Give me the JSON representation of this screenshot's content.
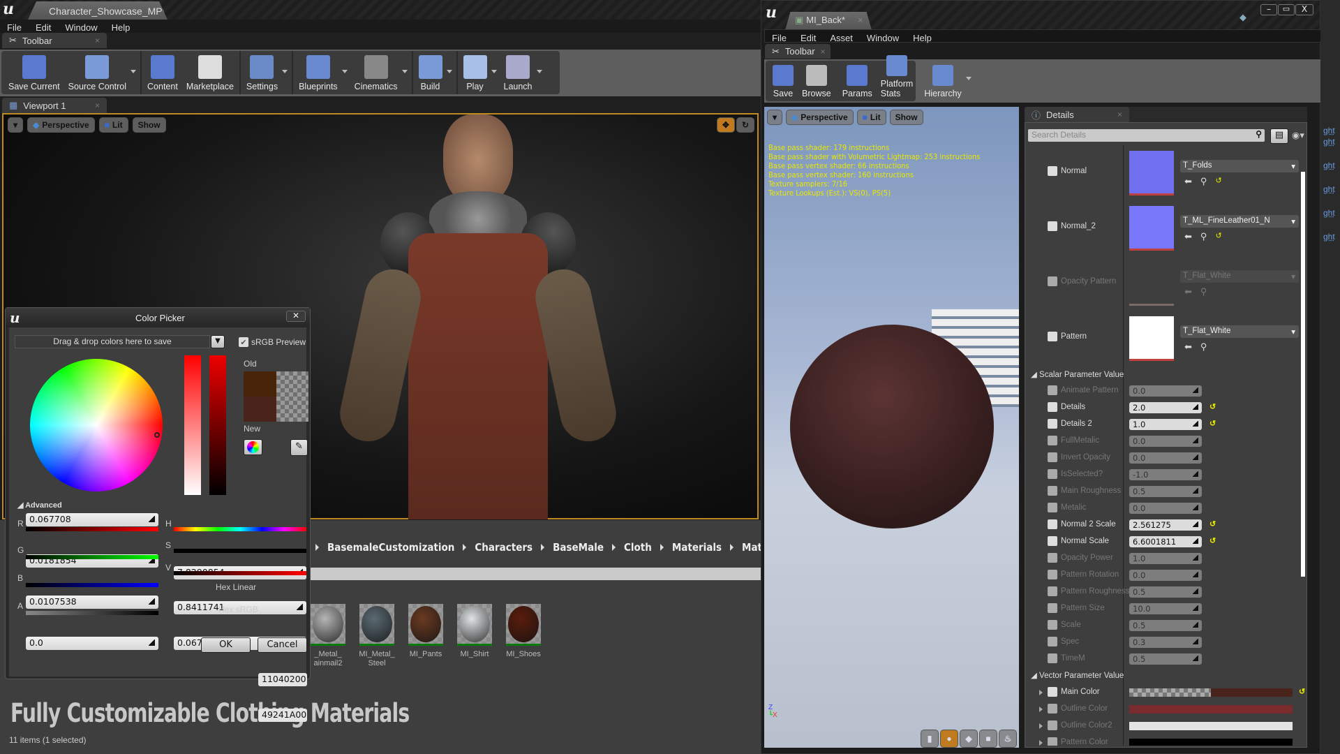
{
  "main_window": {
    "doc_tab": "Character_Showcase_MP*",
    "menu": [
      "File",
      "Edit",
      "Window",
      "Help"
    ],
    "toolbar_tab": "Toolbar",
    "toolbar": [
      {
        "label": "Save Current",
        "icon": "save-icon",
        "dropdown": false
      },
      {
        "label": "Source Control",
        "icon": "source-control-icon",
        "dropdown": true
      },
      {
        "label": "Content",
        "icon": "content-browser-icon",
        "dropdown": false
      },
      {
        "label": "Marketplace",
        "icon": "marketplace-icon",
        "dropdown": false
      },
      {
        "label": "Settings",
        "icon": "settings-icon",
        "dropdown": true
      },
      {
        "label": "Blueprints",
        "icon": "blueprints-icon",
        "dropdown": true
      },
      {
        "label": "Cinematics",
        "icon": "cinematics-icon",
        "dropdown": true
      },
      {
        "label": "Build",
        "icon": "build-icon",
        "dropdown": true
      },
      {
        "label": "Play",
        "icon": "play-icon",
        "dropdown": true
      },
      {
        "label": "Launch",
        "icon": "launch-icon",
        "dropdown": true
      }
    ],
    "viewport_tab": "Viewport 1",
    "viewport_buttons": {
      "perspective": "Perspective",
      "lit": "Lit",
      "show": "Show"
    }
  },
  "color_picker": {
    "title": "Color Picker",
    "theme_bar": "Drag & drop colors here to save",
    "srgb_preview": "sRGB Preview",
    "srgb_checked": true,
    "old_label": "Old",
    "new_label": "New",
    "old_color": "#49240a",
    "new_color": "#49241a",
    "advanced_label": "Advanced",
    "channels": {
      "R": {
        "label": "R",
        "value": "0.067708"
      },
      "G": {
        "label": "G",
        "value": "0.0181854"
      },
      "B": {
        "label": "B",
        "value": "0.0107538"
      },
      "A": {
        "label": "A",
        "value": "0.0"
      },
      "H": {
        "label": "H",
        "value": "7.8290854"
      },
      "S": {
        "label": "S",
        "value": "0.8411741"
      },
      "V": {
        "label": "V",
        "value": "0.067708"
      }
    },
    "hex_linear_label": "Hex Linear",
    "hex_linear": "11040200",
    "hex_srgb_label": "Hex sRGB",
    "hex_srgb": "49241A00",
    "ok": "OK",
    "cancel": "Cancel"
  },
  "content_browser": {
    "breadcrumb": [
      "BasemaleCustomization",
      "Characters",
      "BaseMale",
      "Cloth",
      "Materials",
      "Materia"
    ],
    "assets": [
      {
        "name": "_Metal_\nainmail2",
        "color": "#b5b5b5"
      },
      {
        "name": "MI_Metal_\nSteel",
        "color": "#5a6a72"
      },
      {
        "name": "MI_Pants",
        "color": "#6a3a22"
      },
      {
        "name": "MI_Shirt",
        "color": "#e0e4e6"
      },
      {
        "name": "MI_Shoes",
        "color": "#5a1c0c"
      }
    ],
    "overlay_title": "Fully Customizable Clothing Materials",
    "status": "11 items (1 selected)"
  },
  "material_editor": {
    "doc_tab": "MI_Back*",
    "menu": [
      "File",
      "Edit",
      "Asset",
      "Window",
      "Help"
    ],
    "toolbar_tab": "Toolbar",
    "toolbar": [
      {
        "label": "Save",
        "icon": "save-icon"
      },
      {
        "label": "Browse",
        "icon": "browse-icon"
      },
      {
        "label": "Params",
        "icon": "params-icon"
      },
      {
        "label": "Platform Stats",
        "icon": "platform-stats-icon"
      },
      {
        "label": "Hierarchy",
        "icon": "hierarchy-icon"
      }
    ],
    "viewport_buttons": {
      "perspective": "Perspective",
      "lit": "Lit",
      "show": "Show"
    },
    "stats": [
      "Base pass shader: 179 instructions",
      "Base pass shader with Volumetric Lightmap: 253 instructions",
      "Base pass vertex shader: 66 instructions",
      "Base pass vertex shader: 160 instructions",
      "Texture samplers: 7/16",
      "Texture Lookups (Est.): VS(0), PS(5)"
    ],
    "details_tab": "Details",
    "search_placeholder": "Search Details",
    "textures": [
      {
        "label": "Normal",
        "checked": true,
        "texture": "T_Folds",
        "thumb": "#7070f0",
        "bar": "#c04040",
        "reset": true
      },
      {
        "label": "Normal_2",
        "checked": true,
        "texture": "T_ML_FineLeather01_N",
        "thumb": "#7878fa",
        "bar": "#c04040",
        "reset": true
      },
      {
        "label": "Opacity Pattern",
        "checked": false,
        "texture": "T_Flat_White",
        "thumb": "#3e3e3e",
        "bar": "#7a6a6a",
        "reset": false
      },
      {
        "label": "Pattern",
        "checked": true,
        "texture": "T_Flat_White",
        "thumb": "#ffffff",
        "bar": "#c04040",
        "reset": false
      }
    ],
    "scalar_header": "Scalar Parameter Value",
    "scalars": [
      {
        "label": "Animate Pattern",
        "checked": false,
        "value": "0.0"
      },
      {
        "label": "Details",
        "checked": true,
        "value": "2.0"
      },
      {
        "label": "Details 2",
        "checked": true,
        "value": "1.0"
      },
      {
        "label": "FullMetalic",
        "checked": false,
        "value": "0.0"
      },
      {
        "label": "Invert Opacity",
        "checked": false,
        "value": "0.0"
      },
      {
        "label": "IsSelected?",
        "checked": false,
        "value": "-1.0"
      },
      {
        "label": "Main Roughness",
        "checked": false,
        "value": "0.5"
      },
      {
        "label": "Metalic",
        "checked": false,
        "value": "0.0"
      },
      {
        "label": "Normal 2 Scale",
        "checked": true,
        "value": "2.561275"
      },
      {
        "label": "Normal Scale",
        "checked": true,
        "value": "6.6001811"
      },
      {
        "label": "Opacity Power",
        "checked": false,
        "value": "1.0"
      },
      {
        "label": "Pattern Rotation",
        "checked": false,
        "value": "0.0"
      },
      {
        "label": "Pattern Roughness",
        "checked": false,
        "value": "0.5"
      },
      {
        "label": "Pattern Size",
        "checked": false,
        "value": "10.0"
      },
      {
        "label": "Scale",
        "checked": false,
        "value": "0.5"
      },
      {
        "label": "Spec",
        "checked": false,
        "value": "0.3"
      },
      {
        "label": "TimeM",
        "checked": false,
        "value": "0.5"
      }
    ],
    "vector_header": "Vector Parameter Value",
    "vectors": [
      {
        "label": "Main Color",
        "checked": true,
        "color": "#49241c",
        "alpha_preview": true
      },
      {
        "label": "Outline Color",
        "checked": false,
        "color": "#7b2a2e",
        "alpha_preview": false
      },
      {
        "label": "Outline Color2",
        "checked": false,
        "color": "#e4e4e4",
        "alpha_preview": false
      },
      {
        "label": "Pattern Color",
        "checked": false,
        "color": "#000000",
        "alpha_preview": false
      }
    ],
    "preview_shapes": [
      "cylinder",
      "sphere",
      "plane",
      "cube",
      "teapot"
    ],
    "active_shape": "sphere"
  },
  "side_links": [
    "ght",
    "ght",
    "ght",
    "ght",
    "ght",
    "ght"
  ]
}
